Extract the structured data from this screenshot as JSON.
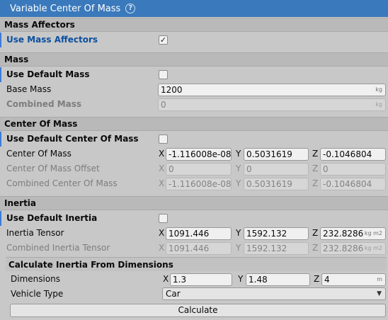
{
  "title": "Variable Center Of Mass",
  "icons": {
    "help": "help-circle-icon",
    "check": "checkmark-icon",
    "dropdown": "chevron-down-icon"
  },
  "sections": {
    "mass_affectors": "Mass Affectors",
    "mass": "Mass",
    "center_of_mass": "Center Of Mass",
    "inertia": "Inertia",
    "calc_inertia": "Calculate Inertia From Dimensions"
  },
  "axes": {
    "x": "X",
    "y": "Y",
    "z": "Z"
  },
  "mass_affectors": {
    "use_label": "Use Mass Affectors",
    "use_checked": true,
    "check_glyph": "✓"
  },
  "mass": {
    "use_default_label": "Use Default Mass",
    "use_default_checked": false,
    "base_label": "Base Mass",
    "base_value": "1200",
    "base_unit": "kg",
    "combined_label": "Combined Mass",
    "combined_value": "0",
    "combined_unit": "kg"
  },
  "com": {
    "use_default_label": "Use Default Center Of Mass",
    "use_default_checked": false,
    "com_label": "Center Of Mass",
    "com": {
      "x": "-1.116008e-08",
      "y": "0.5031619",
      "z": "-0.1046804"
    },
    "offset_label": "Center Of Mass Offset",
    "offset": {
      "x": "0",
      "y": "0",
      "z": "0"
    },
    "combined_label": "Combined Center Of Mass",
    "combined": {
      "x": "-1.116008e-08",
      "y": "0.5031619",
      "z": "-0.1046804"
    }
  },
  "inertia": {
    "use_default_label": "Use Default Inertia",
    "use_default_checked": false,
    "tensor_label": "Inertia Tensor",
    "tensor": {
      "x": "1091.446",
      "y": "1592.132",
      "z": "232.8286",
      "unit": "kg m2"
    },
    "combined_label": "Combined Inertia Tensor",
    "combined": {
      "x": "1091.446",
      "y": "1592.132",
      "z": "232.8286",
      "unit": "kg m2"
    }
  },
  "calc": {
    "dimensions_label": "Dimensions",
    "dimensions": {
      "x": "1.3",
      "y": "1.48",
      "z": "4",
      "unit": "m"
    },
    "vehicle_type_label": "Vehicle Type",
    "vehicle_type_value": "Car",
    "button_label": "Calculate"
  }
}
